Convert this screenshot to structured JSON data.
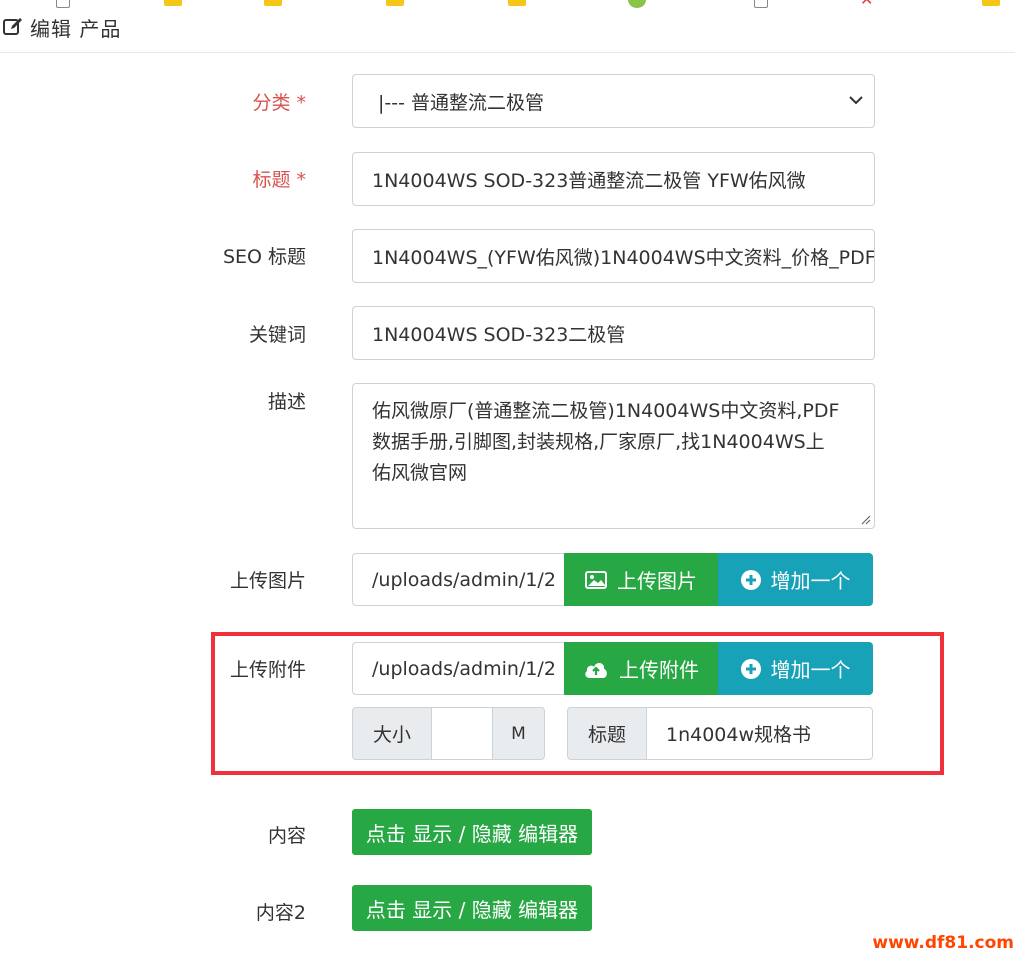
{
  "header": {
    "title": "编辑 产品"
  },
  "form": {
    "category": {
      "label": "分类 *",
      "value": "|--- 普通整流二极管"
    },
    "title": {
      "label": "标题 *",
      "value": "1N4004WS SOD-323普通整流二极管 YFW佑风微"
    },
    "seo_title": {
      "label": "SEO 标题",
      "value": "1N4004WS_(YFW佑风微)1N4004WS中文资料_价格_PDF"
    },
    "keywords": {
      "label": "关键词",
      "value": "1N4004WS SOD-323二极管"
    },
    "description": {
      "label": "描述",
      "lines": [
        "佑风微原厂(普通整流二极管)1N4004WS中文资料,PDF",
        "数据手册,引脚图,封装规格,厂家原厂,找1N4004WS上",
        "佑风微官网"
      ]
    },
    "upload_image": {
      "label": "上传图片",
      "value": "/uploads/admin/1/2",
      "upload_button": "上传图片",
      "add_button": "增加一个"
    },
    "upload_attachment": {
      "label": "上传附件",
      "value": "/uploads/admin/1/2",
      "upload_button": "上传附件",
      "add_button": "增加一个",
      "size_label": "大小",
      "size_value": "",
      "size_unit": "M",
      "title_label": "标题",
      "title_value": "1n4004w规格书"
    },
    "content": {
      "label": "内容",
      "button": "点击 显示 / 隐藏 编辑器"
    },
    "content2": {
      "label": "内容2",
      "button": "点击 显示 / 隐藏 编辑器"
    }
  },
  "watermark": "www.df81.com",
  "colors": {
    "required": "#d9534f",
    "green": "#28a745",
    "teal": "#17a2b8",
    "highlight": "#f0303a",
    "watermark": "#ff4500"
  }
}
